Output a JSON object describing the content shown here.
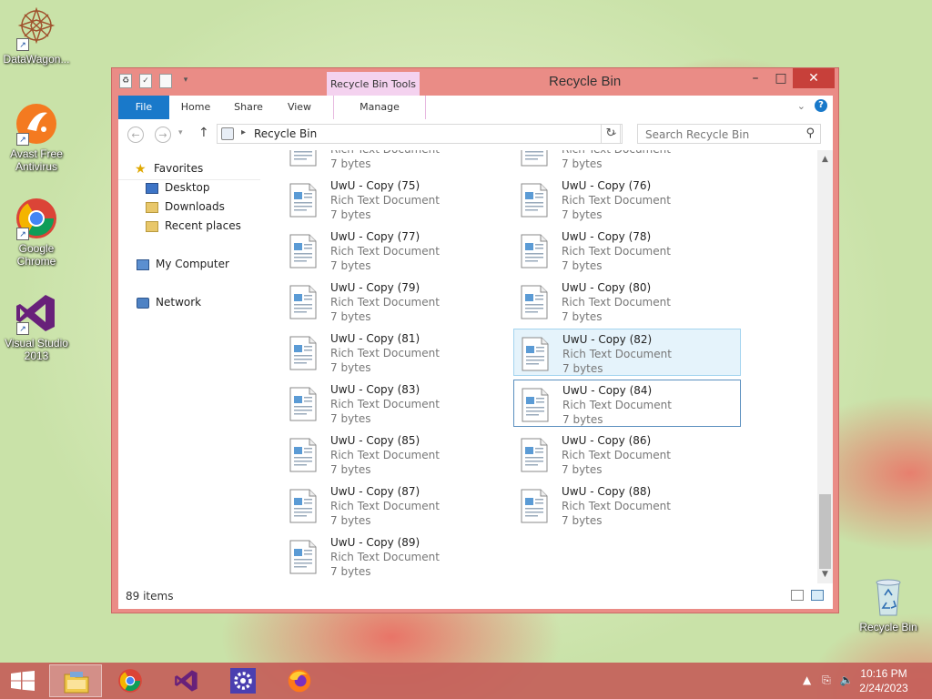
{
  "desktop": {
    "icons": [
      {
        "label": "DataWagon...",
        "icon": "datawagon-icon"
      },
      {
        "label": "Avast Free Antivirus",
        "icon": "avast-icon"
      },
      {
        "label": "Google Chrome",
        "icon": "chrome-icon"
      },
      {
        "label": "Visual Studio 2013",
        "icon": "visual-studio-icon"
      },
      {
        "label": "Recycle Bin",
        "icon": "recycle-bin-icon"
      }
    ]
  },
  "window": {
    "title": "Recycle Bin",
    "context_tab": "Recycle Bin Tools",
    "controls": {
      "minimize": "–",
      "maximize": "□",
      "close": "✕"
    }
  },
  "ribbon": {
    "tabs": {
      "file": "File",
      "home": "Home",
      "share": "Share",
      "view": "View",
      "manage": "Manage"
    },
    "help": "?"
  },
  "address": {
    "path": "Recycle Bin",
    "search_placeholder": "Search Recycle Bin"
  },
  "nav": {
    "favorites": "Favorites",
    "desktop": "Desktop",
    "downloads": "Downloads",
    "recent": "Recent places",
    "my_computer": "My Computer",
    "network": "Network"
  },
  "files": {
    "partial_type": "Rich Text Document",
    "partial_size": "7 bytes",
    "items": [
      {
        "name": "UwU - Copy (75)",
        "type": "Rich Text Document",
        "size": "7 bytes"
      },
      {
        "name": "UwU - Copy (76)",
        "type": "Rich Text Document",
        "size": "7 bytes"
      },
      {
        "name": "UwU - Copy (77)",
        "type": "Rich Text Document",
        "size": "7 bytes"
      },
      {
        "name": "UwU - Copy (78)",
        "type": "Rich Text Document",
        "size": "7 bytes"
      },
      {
        "name": "UwU - Copy (79)",
        "type": "Rich Text Document",
        "size": "7 bytes"
      },
      {
        "name": "UwU - Copy (80)",
        "type": "Rich Text Document",
        "size": "7 bytes"
      },
      {
        "name": "UwU - Copy (81)",
        "type": "Rich Text Document",
        "size": "7 bytes"
      },
      {
        "name": "UwU - Copy (82)",
        "type": "Rich Text Document",
        "size": "7 bytes"
      },
      {
        "name": "UwU - Copy (83)",
        "type": "Rich Text Document",
        "size": "7 bytes"
      },
      {
        "name": "UwU - Copy (84)",
        "type": "Rich Text Document",
        "size": "7 bytes"
      },
      {
        "name": "UwU - Copy (85)",
        "type": "Rich Text Document",
        "size": "7 bytes"
      },
      {
        "name": "UwU - Copy (86)",
        "type": "Rich Text Document",
        "size": "7 bytes"
      },
      {
        "name": "UwU - Copy (87)",
        "type": "Rich Text Document",
        "size": "7 bytes"
      },
      {
        "name": "UwU - Copy (88)",
        "type": "Rich Text Document",
        "size": "7 bytes"
      },
      {
        "name": "UwU - Copy (89)",
        "type": "Rich Text Document",
        "size": "7 bytes"
      }
    ]
  },
  "status": {
    "count": "89 items"
  },
  "taskbar": {
    "apps": [
      "file-explorer-icon",
      "chrome-icon",
      "visual-studio-icon",
      "settings-icon",
      "firefox-icon"
    ],
    "time": "10:16 PM",
    "date": "2/24/2023"
  },
  "colors": {
    "accent": "#1979ca",
    "window_frame": "#ea8c86",
    "selection": "#e5f3fb",
    "context_tab": "#f4d2ef"
  }
}
